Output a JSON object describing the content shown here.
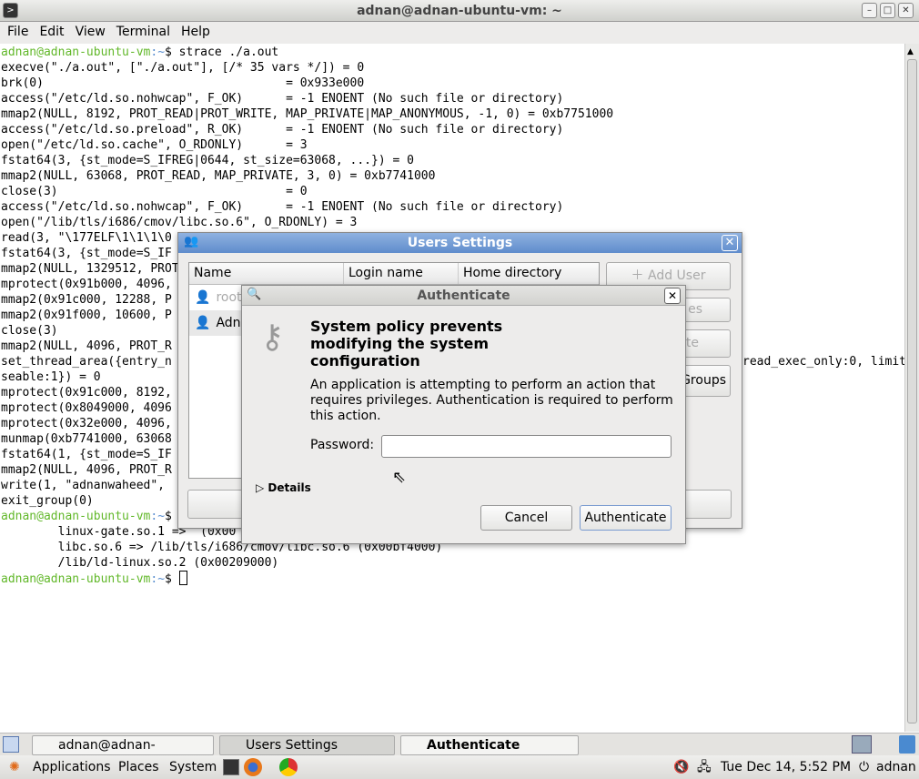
{
  "window": {
    "title": "adnan@adnan-ubuntu-vm: ~"
  },
  "menu": [
    "File",
    "Edit",
    "View",
    "Terminal",
    "Help"
  ],
  "terminal": {
    "prompt_user": "adnan@adnan-ubuntu-vm",
    "prompt_path": ":~",
    "prompt_sym": "$ ",
    "command": "strace ./a.out",
    "lines": [
      "execve(\"./a.out\", [\"./a.out\"], [/* 35 vars */]) = 0",
      "brk(0)                                  = 0x933e000",
      "access(\"/etc/ld.so.nohwcap\", F_OK)      = -1 ENOENT (No such file or directory)",
      "mmap2(NULL, 8192, PROT_READ|PROT_WRITE, MAP_PRIVATE|MAP_ANONYMOUS, -1, 0) = 0xb7751000",
      "access(\"/etc/ld.so.preload\", R_OK)      = -1 ENOENT (No such file or directory)",
      "open(\"/etc/ld.so.cache\", O_RDONLY)      = 3",
      "fstat64(3, {st_mode=S_IFREG|0644, st_size=63068, ...}) = 0",
      "mmap2(NULL, 63068, PROT_READ, MAP_PRIVATE, 3, 0) = 0xb7741000",
      "close(3)                                = 0",
      "access(\"/etc/ld.so.nohwcap\", F_OK)      = -1 ENOENT (No such file or directory)",
      "open(\"/lib/tls/i686/cmov/libc.so.6\", O_RDONLY) = 3",
      "read(3, \"\\177ELF\\1\\1\\1\\0",
      "fstat64(3, {st_mode=S_IF",
      "mmap2(NULL, 1329512, PROT",
      "mprotect(0x91b000, 4096,",
      "mmap2(0x91c000, 12288, P",
      "mmap2(0x91f000, 10600, P",
      "close(3)",
      "mmap2(NULL, 4096, PROT_R",
      "set_thread_area({entry_n",
      "seable:1}) = 0",
      "mprotect(0x91c000, 8192,",
      "mprotect(0x8049000, 4096",
      "mprotect(0x32e000, 4096,",
      "munmap(0xb7741000, 63068",
      "fstat64(1, {st_mode=S_IF",
      "mmap2(NULL, 4096, PROT_R",
      "write(1, \"adnanwaheed\",",
      "exit_group(0)"
    ],
    "set_thread_tail": "read_exec_only:0, limit",
    "ldd_lines": [
      "        linux-gate.so.1 =>  (0x00",
      "        libc.so.6 => /lib/tls/i686/cmov/libc.so.6 (0x00bf4000)",
      "        /lib/ld-linux.so.2 (0x00209000)"
    ]
  },
  "users_settings": {
    "title": "Users Settings",
    "columns": [
      "Name",
      "Login name",
      "Home directory"
    ],
    "rows": [
      {
        "name": "root",
        "disabled": true
      },
      {
        "name": "Adna",
        "disabled": false
      }
    ],
    "buttons": {
      "add_user": "Add User",
      "properties": "es",
      "delete": "te",
      "groups": "Groups"
    }
  },
  "authenticate": {
    "title": "Authenticate",
    "heading": "System policy prevents modifying the system configuration",
    "message": "An application is attempting to perform an action that requires privileges. Authentication is required to perform this action.",
    "password_label": "Password:",
    "password_value": "",
    "details": "Details",
    "cancel": "Cancel",
    "ok": "Authenticate"
  },
  "taskbar": [
    "adnan@adnan-ubuntu-...",
    "Users Settings",
    "Authenticate"
  ],
  "panel": {
    "menus": [
      "Applications",
      "Places",
      "System"
    ],
    "clock": "Tue Dec 14,  5:52 PM",
    "user": "adnan"
  },
  "colors": {
    "prompt_user": "#62b82a",
    "prompt_path": "#5b8fd0",
    "titlebar_active": "#6f98d4"
  }
}
